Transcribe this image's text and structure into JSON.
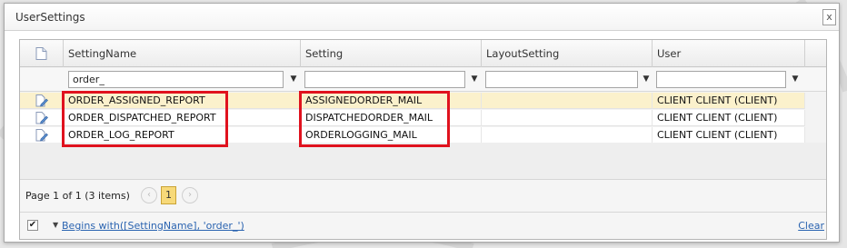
{
  "window": {
    "title": "UserSettings",
    "close_label": "x"
  },
  "grid": {
    "columns": [
      "SettingName",
      "Setting",
      "LayoutSetting",
      "User"
    ],
    "filters": {
      "SettingName": "order_",
      "Setting": "",
      "LayoutSetting": "",
      "User": ""
    },
    "rows": [
      {
        "setting_name": "ORDER_ASSIGNED_REPORT",
        "setting": "ASSIGNEDORDER_MAIL",
        "layout_setting": "",
        "user": "CLIENT CLIENT (CLIENT)",
        "selected": true
      },
      {
        "setting_name": "ORDER_DISPATCHED_REPORT",
        "setting": "DISPATCHEDORDER_MAIL",
        "layout_setting": "",
        "user": "CLIENT CLIENT (CLIENT)",
        "selected": false
      },
      {
        "setting_name": "ORDER_LOG_REPORT",
        "setting": "ORDERLOGGING_MAIL",
        "layout_setting": "",
        "user": "CLIENT CLIENT (CLIENT)",
        "selected": false
      }
    ]
  },
  "pager": {
    "summary_prefix": "Page 1 of 1 (",
    "summary_suffix": " items)",
    "items_count": "3",
    "current_page": "1",
    "prev_glyph": "‹",
    "next_glyph": "›"
  },
  "status": {
    "filter_enabled": true,
    "filter_expression": "Begins with([SettingName], 'order_')",
    "clear_label": "Clear"
  },
  "colors": {
    "highlight": "#e0121e",
    "selected_row": "#fbf1cc",
    "page_active": "#f7d979",
    "link": "#2a63b0"
  }
}
